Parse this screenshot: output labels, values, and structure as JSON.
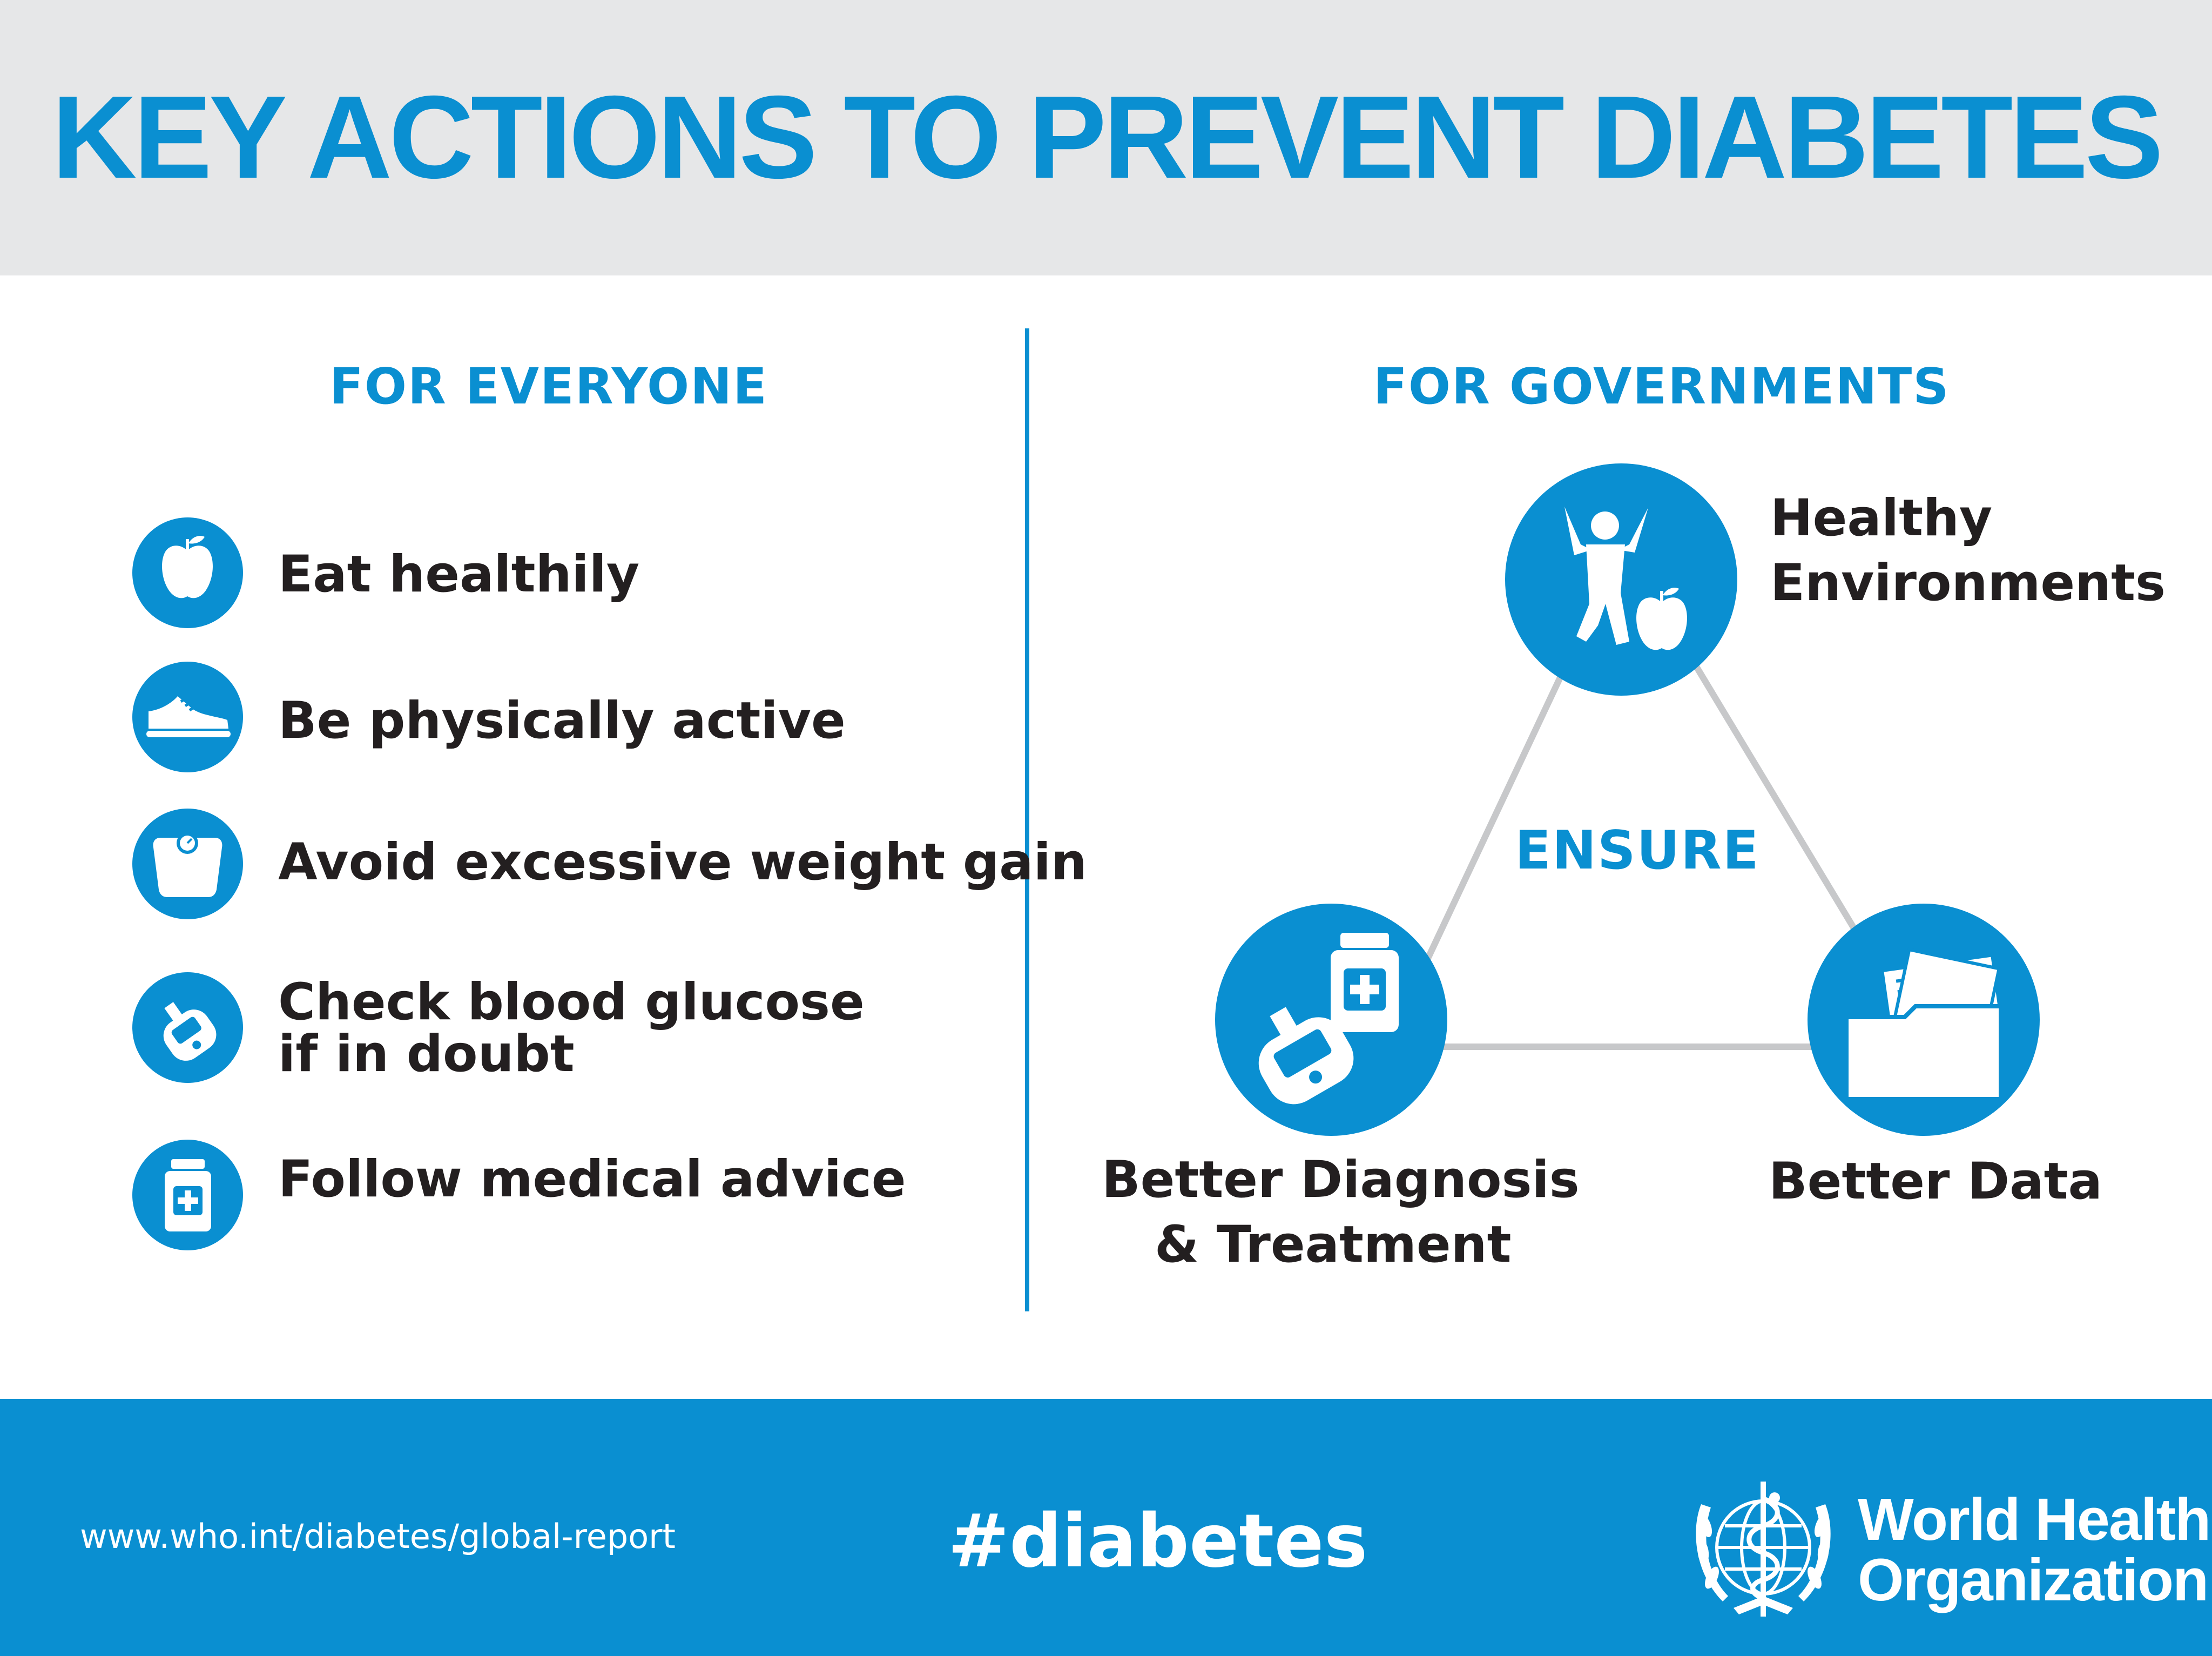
{
  "title": "KEY ACTIONS TO PREVENT DIABETES",
  "everyone": {
    "heading": "FOR EVERYONE",
    "items": [
      {
        "label": "Eat healthily",
        "icon": "apple-icon"
      },
      {
        "label": "Be physically active",
        "icon": "sneaker-icon"
      },
      {
        "label": "Avoid excessive weight gain",
        "icon": "scale-icon"
      },
      {
        "label_line1": "Check blood glucose",
        "label_line2": "if in doubt",
        "icon": "glucose-meter-icon"
      },
      {
        "label": "Follow medical advice",
        "icon": "medicine-bottle-icon"
      }
    ]
  },
  "governments": {
    "heading": "FOR GOVERNMENTS",
    "center_label": "ENSURE",
    "nodes": [
      {
        "line1": "Healthy",
        "line2": "Environments",
        "icon": "active-person-apple-icon"
      },
      {
        "line1": "Better Diagnosis",
        "line2": "& Treatment",
        "icon": "glucose-meter-medicine-icon"
      },
      {
        "line1": "Better Data",
        "icon": "folder-documents-icon"
      }
    ]
  },
  "footer": {
    "url": "www.who.int/diabetes/global-report",
    "hashtag": "#diabetes",
    "org_line1": "World Health",
    "org_line2": "Organization"
  },
  "colors": {
    "accent": "#0a8fd1",
    "header_bg": "#e6e7e8",
    "text": "#231f20",
    "connector": "#c7c8ca"
  }
}
